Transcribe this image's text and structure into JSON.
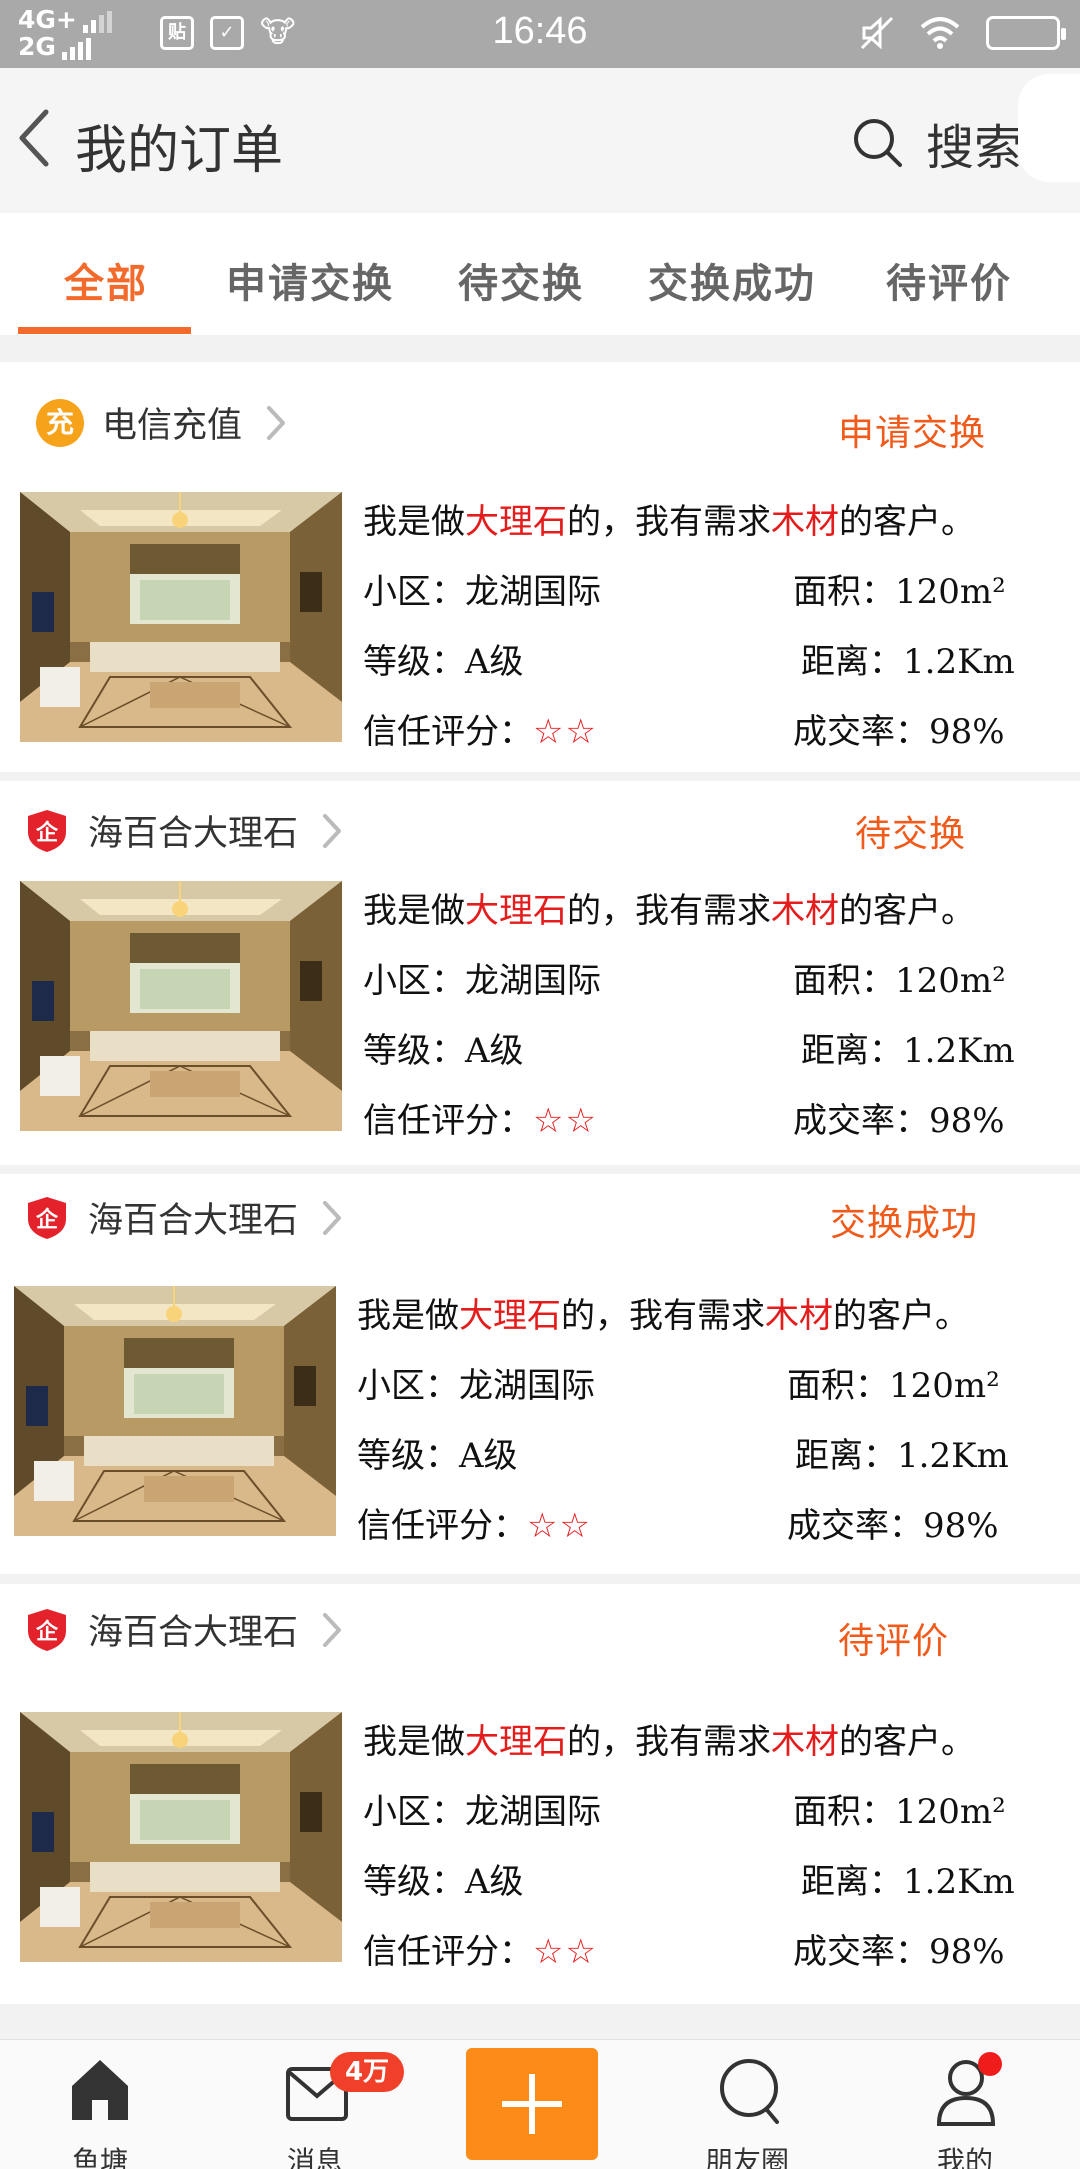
{
  "status_bar": {
    "net_top": "4G+",
    "net_bottom": "2G",
    "icon_names": [
      "tieba-icon",
      "check-icon",
      "cow-icon"
    ],
    "time": "16:46"
  },
  "header": {
    "title": "我的订单",
    "search_label": "搜索"
  },
  "tabs": [
    {
      "label": "全部",
      "active": true
    },
    {
      "label": "申请交换",
      "active": false
    },
    {
      "label": "待交换",
      "active": false
    },
    {
      "label": "交换成功",
      "active": false
    },
    {
      "label": "待评价",
      "active": false
    }
  ],
  "orders": [
    {
      "shop": "电信充值",
      "shop_logo": "充",
      "status": "申请交换",
      "desc_pre": "我是做",
      "desc_hl1": "大理石",
      "desc_mid": "的，我有需求",
      "desc_hl2": "木材",
      "desc_post": "的客户。",
      "community": "小区：龙湖国际",
      "area": "面积：120m²",
      "grade": "等级：A级",
      "distance": "距离：1.2Km",
      "trust_label": "信任评分：",
      "trust_stars": "☆☆",
      "deal_rate": "成交率：98%"
    },
    {
      "shop": "海百合大理石",
      "shop_logo": "企",
      "status": "待交换",
      "desc_pre": "我是做",
      "desc_hl1": "大理石",
      "desc_mid": "的，我有需求",
      "desc_hl2": "木材",
      "desc_post": "的客户。",
      "community": "小区：龙湖国际",
      "area": "面积：120m²",
      "grade": "等级：A级",
      "distance": "距离：1.2Km",
      "trust_label": "信任评分：",
      "trust_stars": "☆☆",
      "deal_rate": "成交率：98%"
    },
    {
      "shop": "海百合大理石",
      "shop_logo": "企",
      "status": "交换成功",
      "desc_pre": "我是做",
      "desc_hl1": "大理石",
      "desc_mid": "的，我有需求",
      "desc_hl2": "木材",
      "desc_post": "的客户。",
      "community": "小区：龙湖国际",
      "area": "面积：120m²",
      "grade": "等级：A级",
      "distance": "距离：1.2Km",
      "trust_label": "信任评分：",
      "trust_stars": "☆☆",
      "deal_rate": "成交率：98%"
    },
    {
      "shop": "海百合大理石",
      "shop_logo": "企",
      "status": "待评价",
      "desc_pre": "我是做",
      "desc_hl1": "大理石",
      "desc_mid": "的，我有需求",
      "desc_hl2": "木材",
      "desc_post": "的客户。",
      "community": "小区：龙湖国际",
      "area": "面积：120m²",
      "grade": "等级：A级",
      "distance": "距离：1.2Km",
      "trust_label": "信任评分：",
      "trust_stars": "☆☆",
      "deal_rate": "成交率：98%"
    }
  ],
  "bottom_nav": {
    "items": [
      {
        "label": "鱼塘",
        "icon": "home-icon"
      },
      {
        "label": "消息",
        "icon": "mail-icon"
      },
      {
        "label": "",
        "icon": "plus-icon"
      },
      {
        "label": "朋友圈",
        "icon": "search-circle-icon"
      },
      {
        "label": "我的",
        "icon": "person-icon"
      }
    ],
    "message_badge": "4万"
  },
  "colors": {
    "accent": "#f26b2c",
    "status_text": "#f05a1a",
    "highlight_red": "#e51c1c",
    "add_button": "#fb8a16",
    "status_bar": "#a9a9a9"
  }
}
